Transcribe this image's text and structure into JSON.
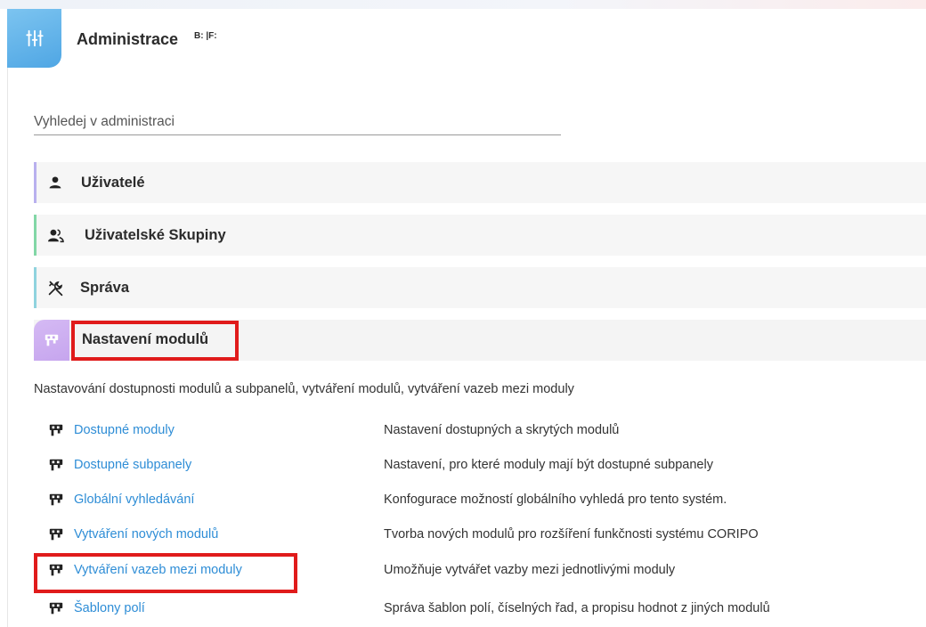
{
  "header": {
    "title": "Administrace",
    "sub": "B: |F:",
    "accent": "#4fa6e4"
  },
  "search": {
    "placeholder": "Vyhledej v administraci",
    "value": ""
  },
  "sections": {
    "users": {
      "label": "Uživatelé",
      "icon": "user-icon",
      "color": "#b9b0ee"
    },
    "groups": {
      "label": "Uživatelské Skupiny",
      "icon": "users-group-icon",
      "color": "#82d7a6"
    },
    "admin": {
      "label": "Správa",
      "icon": "tools-icon",
      "color": "#8fd3de"
    },
    "modules": {
      "label": "Nastavení modulů",
      "icon": "module-settings-icon",
      "color": "#c6a5ee",
      "description": "Nastavování dostupnosti modulů a subpanelů, vytváření modulů, vytváření vazeb mezi moduly",
      "items": [
        {
          "link": "Dostupné moduly",
          "desc": "Nastavení dostupných a skrytých modulů"
        },
        {
          "link": "Dostupné subpanely",
          "desc": "Nastavení, pro které moduly mají být dostupné subpanely"
        },
        {
          "link": "Globální vyhledávání",
          "desc": "Konfogurace možností globálního vyhledá pro tento systém."
        },
        {
          "link": "Vytváření nových modulů",
          "desc": "Tvorba nových modulů pro rozšíření funkčnosti systému CORIPO"
        },
        {
          "link": "Vytváření vazeb mezi moduly",
          "desc": "Umožňuje vytvářet vazby mezi jednotlivými moduly"
        },
        {
          "link": "Šablony polí",
          "desc": "Správa šablon polí, číselných řad, a propisu hodnot z jiných modulů"
        }
      ]
    }
  },
  "colors": {
    "link": "#2e8dd6",
    "highlight": "#e01b1b"
  }
}
